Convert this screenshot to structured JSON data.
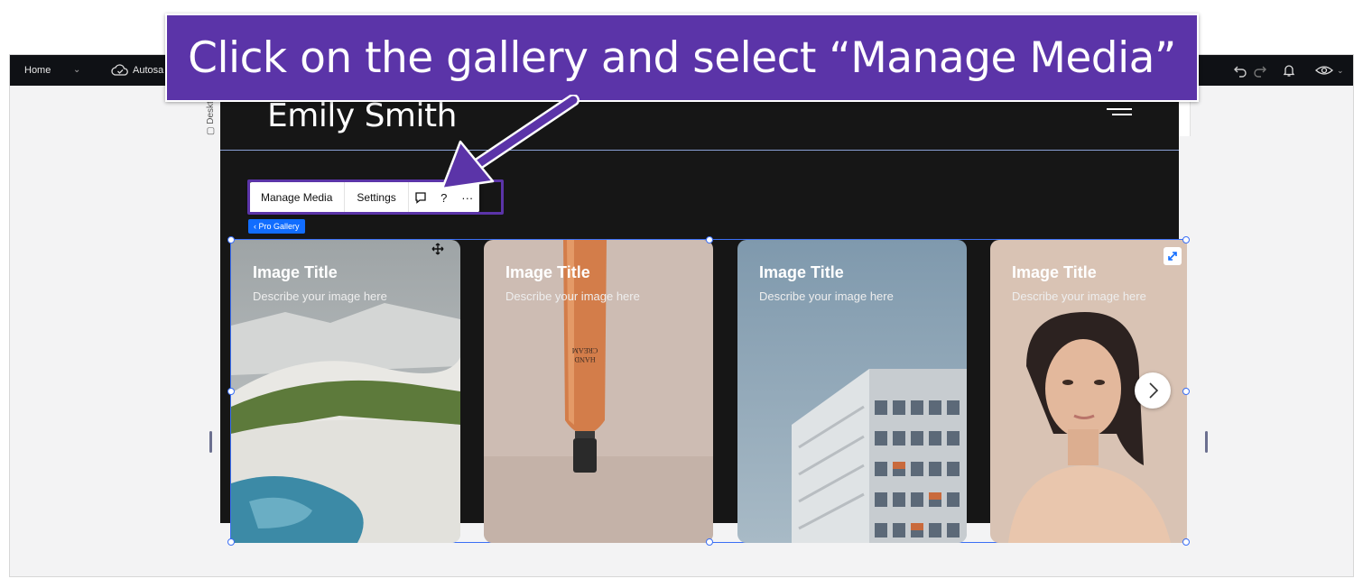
{
  "callout": {
    "text": "Click on the gallery and select “Manage Media”"
  },
  "topbar": {
    "page_label": "Home",
    "autosave_label": "Autosa"
  },
  "canvas": {
    "device_label": "Desktop (Primary)"
  },
  "site": {
    "title": "Emily Smith"
  },
  "toolbar": {
    "manage_media_label": "Manage Media",
    "settings_label": "Settings",
    "help_label": "?",
    "more_label": "···"
  },
  "gallery": {
    "tag_label": "‹ Pro Gallery",
    "items": [
      {
        "title": "Image Title",
        "description": "Describe your image here"
      },
      {
        "title": "Image Title",
        "description": "Describe your image here"
      },
      {
        "title": "Image Title",
        "description": "Describe your image here"
      },
      {
        "title": "Image Title",
        "description": "Describe your image here"
      }
    ]
  },
  "product_label": {
    "line1": "HAND",
    "line2": "CREAM"
  },
  "colors": {
    "callout": "#5b34a8",
    "selection": "#3b6ff5",
    "tag": "#116dff",
    "topbar": "#0f1115"
  }
}
